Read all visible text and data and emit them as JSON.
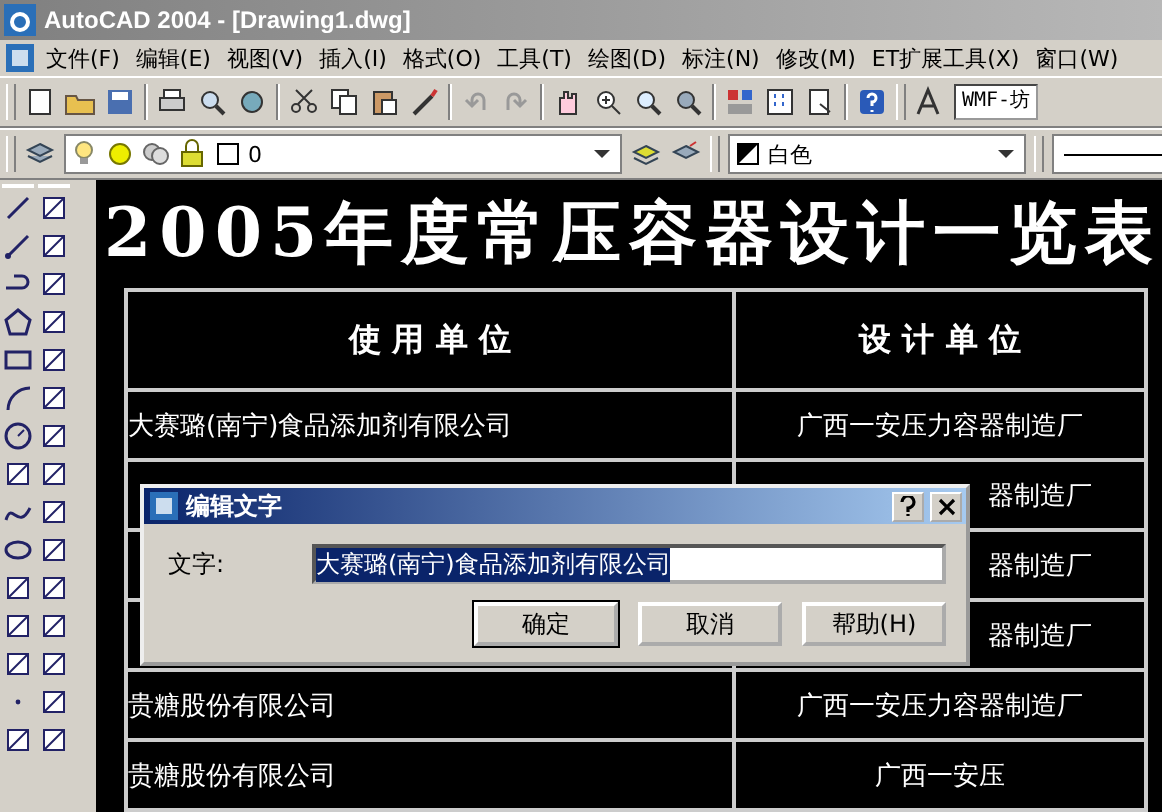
{
  "window": {
    "title": "AutoCAD 2004 - [Drawing1.dwg]"
  },
  "menu": [
    "文件(F)",
    "编辑(E)",
    "视图(V)",
    "插入(I)",
    "格式(O)",
    "工具(T)",
    "绘图(D)",
    "标注(N)",
    "修改(M)",
    "ET扩展工具(X)",
    "窗口(W)"
  ],
  "toolbar": {
    "text_style": "WMF-坊"
  },
  "properties_bar": {
    "layer": "0",
    "color_name": "白色"
  },
  "drawing": {
    "title": "2005年度常压容器设计一览表",
    "columns": [
      "使 用 单 位",
      "设 计 单 位"
    ],
    "rows": [
      {
        "kind": "full",
        "user": "大赛璐(南宁)食品添加剂有限公司",
        "designer": "广西一安压力容器制造厂"
      },
      {
        "kind": "covered",
        "designer": "器制造厂"
      },
      {
        "kind": "covered",
        "designer": "器制造厂"
      },
      {
        "kind": "covered",
        "designer": "器制造厂"
      },
      {
        "kind": "full",
        "user": "贵糖股份有限公司",
        "designer": "广西一安压力容器制造厂"
      },
      {
        "kind": "full",
        "user": "贵糖股份有限公司",
        "designer": "广西一安压"
      }
    ]
  },
  "dialog": {
    "title": "编辑文字",
    "label": "文字:",
    "value": "大赛璐(南宁)食品添加剂有限公司",
    "value_selected": true,
    "buttons": [
      "确定",
      "取消",
      "帮助(H)"
    ]
  }
}
